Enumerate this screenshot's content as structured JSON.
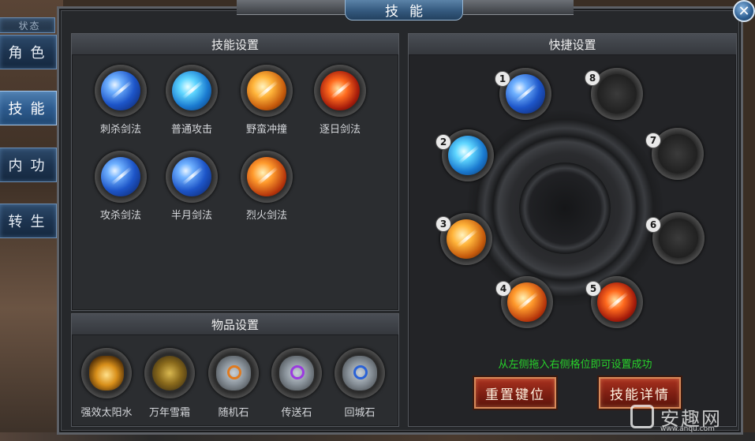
{
  "window": {
    "title": "技能",
    "close_icon": "close-icon"
  },
  "side_tabs": [
    {
      "label": "角色",
      "active": false
    },
    {
      "label": "技能",
      "active": true
    },
    {
      "label": "内功",
      "active": false
    },
    {
      "label": "转生",
      "active": false
    }
  ],
  "side_tab_partial": "状态",
  "skill_panel": {
    "title": "技能设置",
    "skills": [
      {
        "name": "刺杀剑法",
        "icon": "thrust-sword-icon",
        "color": "blue"
      },
      {
        "name": "普通攻击",
        "icon": "normal-attack-icon",
        "color": "cyan"
      },
      {
        "name": "野蛮冲撞",
        "icon": "savage-charge-icon",
        "color": "orange"
      },
      {
        "name": "逐日剑法",
        "icon": "sun-chaser-sword-icon",
        "color": "red"
      },
      {
        "name": "攻杀剑法",
        "icon": "assault-sword-icon",
        "color": "blue"
      },
      {
        "name": "半月剑法",
        "icon": "half-moon-sword-icon",
        "color": "blue"
      },
      {
        "name": "烈火剑法",
        "icon": "blazing-sword-icon",
        "color": "fire"
      }
    ]
  },
  "item_panel": {
    "title": "物品设置",
    "items": [
      {
        "name": "强效太阳水",
        "icon": "sun-potion-icon"
      },
      {
        "name": "万年雪霜",
        "icon": "snow-frost-herb-icon"
      },
      {
        "name": "随机石",
        "icon": "random-stone-icon",
        "accent": "#e07a1e"
      },
      {
        "name": "传送石",
        "icon": "teleport-stone-icon",
        "accent": "#9b3ae0"
      },
      {
        "name": "回城石",
        "icon": "return-town-stone-icon",
        "accent": "#2a62d6"
      }
    ]
  },
  "shortcut_panel": {
    "title": "快捷设置",
    "slots": [
      {
        "number": "1",
        "skill": "thrust-sword-icon",
        "color": "blue"
      },
      {
        "number": "2",
        "skill": "half-moon-sword-icon",
        "color": "cyan"
      },
      {
        "number": "3",
        "skill": "savage-charge-icon",
        "color": "orange"
      },
      {
        "number": "4",
        "skill": "blazing-sword-icon",
        "color": "fire"
      },
      {
        "number": "5",
        "skill": "sun-chaser-sword-icon",
        "color": "red"
      },
      {
        "number": "6",
        "skill": "",
        "color": "empty"
      },
      {
        "number": "7",
        "skill": "",
        "color": "empty"
      },
      {
        "number": "8",
        "skill": "",
        "color": "empty"
      }
    ],
    "hint": "从左侧拖入右侧格位即可设置成功",
    "reset_button": "重置键位",
    "details_button": "技能详情"
  },
  "watermark": {
    "brand": "安趣网",
    "url": "www.anqu.com"
  },
  "colors": {
    "hint_green": "#27d22b",
    "button_red": "#8a2416",
    "tab_blue": "#2e5c8f"
  }
}
